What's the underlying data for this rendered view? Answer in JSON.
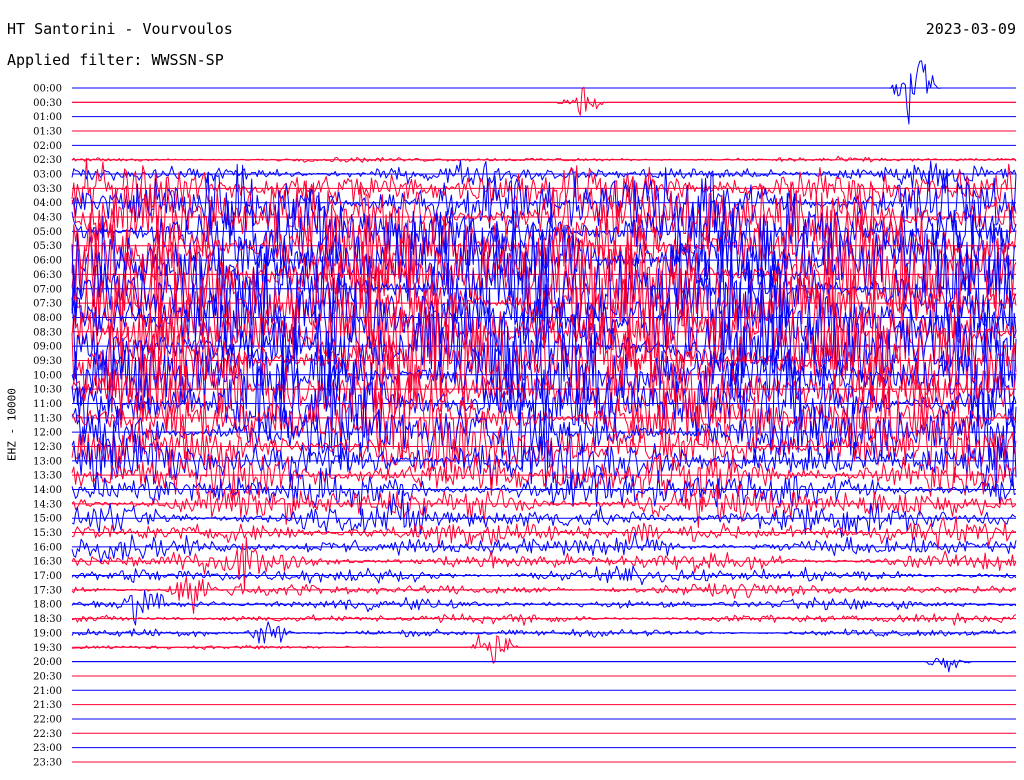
{
  "header": {
    "title": "HT Santorini - Vourvoulos",
    "filter": "Applied filter: WWSSN-SP",
    "date": "2023-03-09"
  },
  "chart_data": {
    "type": "line",
    "ylabel": "EHZ - 10000",
    "tick_labels": [
      "00:00",
      "00:30",
      "01:00",
      "01:30",
      "02:00",
      "02:30",
      "03:00",
      "03:30",
      "04:00",
      "04:30",
      "05:00",
      "05:30",
      "06:00",
      "06:30",
      "07:00",
      "07:30",
      "08:00",
      "08:30",
      "09:00",
      "09:30",
      "10:00",
      "10:30",
      "11:00",
      "11:30",
      "12:00",
      "12:30",
      "13:00",
      "13:30",
      "14:00",
      "14:30",
      "15:00",
      "15:30",
      "16:00",
      "16:30",
      "17:00",
      "17:30",
      "18:00",
      "18:30",
      "19:00",
      "19:30",
      "20:00",
      "20:30",
      "21:00",
      "21:30",
      "22:00",
      "22:30",
      "23:00",
      "23:30"
    ],
    "x_range_minutes": [
      0,
      30
    ],
    "colors": {
      "even_trace": "#0000ff",
      "odd_trace": "#ff0033"
    },
    "trace_amplitude": [
      0,
      0,
      0,
      0,
      0,
      0.3,
      1.2,
      3.2,
      4.5,
      5.2,
      5.8,
      6.2,
      6.6,
      6.8,
      7.0,
      7.0,
      7.0,
      6.8,
      6.6,
      6.3,
      6.0,
      5.6,
      5.2,
      4.8,
      4.4,
      4.0,
      3.5,
      3.0,
      2.6,
      2.2,
      1.9,
      1.6,
      1.4,
      1.2,
      1.0,
      0.8,
      0.7,
      0.6,
      0.5,
      0.3,
      0,
      0,
      0,
      0,
      0,
      0,
      0,
      0
    ],
    "events": [
      {
        "trace": "00:30",
        "minute": 16.2,
        "peak": 2.3
      },
      {
        "trace": "00:00",
        "minute": 26.8,
        "peak": 6.0
      },
      {
        "trace": "04:00",
        "minute": 20.5,
        "peak": 1.5
      },
      {
        "trace": "13:30",
        "minute": 13.3,
        "peak": 1.0
      },
      {
        "trace": "15:00",
        "minute": 10.5,
        "peak": 1.2
      },
      {
        "trace": "15:30",
        "minute": 18.0,
        "peak": 1.0
      },
      {
        "trace": "16:30",
        "minute": 5.5,
        "peak": 1.8
      },
      {
        "trace": "17:30",
        "minute": 3.8,
        "peak": 2.3
      },
      {
        "trace": "18:00",
        "minute": 2.3,
        "peak": 3.5
      },
      {
        "trace": "19:00",
        "minute": 6.3,
        "peak": 2.0
      },
      {
        "trace": "19:30",
        "minute": 13.4,
        "peak": 2.5
      },
      {
        "trace": "20:00",
        "minute": 27.8,
        "peak": 1.2
      }
    ]
  }
}
